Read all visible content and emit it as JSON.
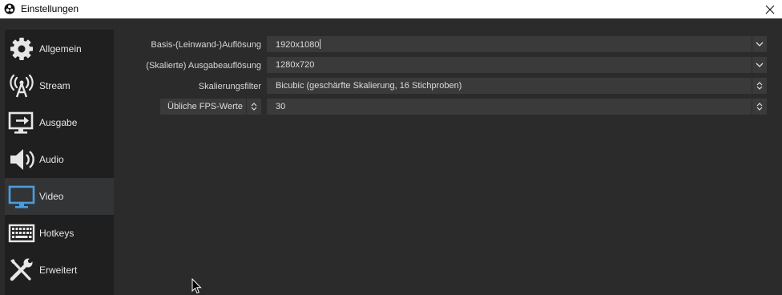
{
  "window": {
    "title": "Einstellungen"
  },
  "sidebar": {
    "items": [
      {
        "label": "Allgemein",
        "icon": "gear-icon",
        "active": false
      },
      {
        "label": "Stream",
        "icon": "broadcast-icon",
        "active": false
      },
      {
        "label": "Ausgabe",
        "icon": "output-icon",
        "active": false
      },
      {
        "label": "Audio",
        "icon": "speaker-icon",
        "active": false
      },
      {
        "label": "Video",
        "icon": "monitor-icon",
        "active": true
      },
      {
        "label": "Hotkeys",
        "icon": "keyboard-icon",
        "active": false
      },
      {
        "label": "Erweitert",
        "icon": "wrench-icon",
        "active": false
      }
    ]
  },
  "video": {
    "base_resolution": {
      "label": "Basis-(Leinwand-)Auflösung",
      "value": "1920x1080"
    },
    "output_resolution": {
      "label": "(Skalierte) Ausgabeauflösung",
      "value": "1280x720"
    },
    "downscale_filter": {
      "label": "Skalierungsfilter",
      "value": "Bicubic (geschärfte Skalierung, 16 Stichproben)"
    },
    "fps": {
      "type_label": "Übliche FPS-Werte",
      "value": "30"
    }
  },
  "colors": {
    "background": "#2b2b2b",
    "sidebar": "#1f1f1f",
    "sidebar_active": "#333436",
    "field": "#3a3a3a",
    "icon": "#e6e6e6",
    "video_icon": "#4a9de0"
  }
}
